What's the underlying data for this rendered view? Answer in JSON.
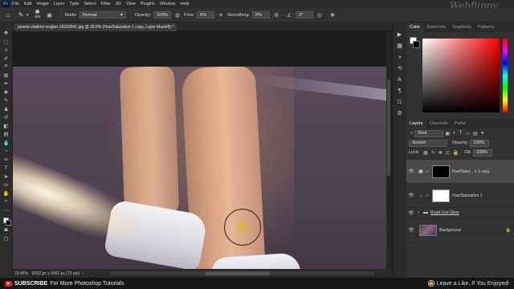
{
  "menubar": {
    "logo": "Ps",
    "items": [
      "File",
      "Edit",
      "Image",
      "Layer",
      "Type",
      "Select",
      "Filter",
      "3D",
      "View",
      "Plugins",
      "Window",
      "Help"
    ],
    "watermark": "Webflippy"
  },
  "options": {
    "brush_size": "400",
    "mode_label": "Mode:",
    "mode_value": "Normal",
    "opacity_label": "Opacity:",
    "opacity_value": "100%",
    "flow_label": "Flow:",
    "flow_value": "5%",
    "smoothing_label": "Smoothing:",
    "smoothing_value": "0%",
    "angle_value": "0°"
  },
  "document": {
    "tab_title": "pexels-vladimir-srajber-18103941.jpg @ 29.5% (Hue/Saturation 1 copy, Layer Mask/8) *"
  },
  "status": {
    "zoom": "29.46%",
    "info": "8192 px x 5462 px (72 ppi)"
  },
  "color_panel": {
    "tabs": [
      "Color",
      "Swatches",
      "Gradients",
      "Patterns"
    ],
    "fg": "#ffffff",
    "bg": "#000000"
  },
  "layers_panel": {
    "tabs": [
      "Layers",
      "Channels",
      "Paths"
    ],
    "kind_label": "Kind",
    "blend_mode": "Screen",
    "opacity_label": "Opacity:",
    "opacity_value": "100%",
    "lock_label": "Lock:",
    "fill_label": "Fill:",
    "fill_value": "100%",
    "layers": [
      {
        "name": "Hue/Satur... n 1 copy",
        "selected": true,
        "mask": "black"
      },
      {
        "name": "Hue/Saturation 1",
        "selected": false,
        "mask": "white"
      },
      {
        "name": "Road Line Glow",
        "selected": false
      },
      {
        "name": "Background",
        "selected": false
      }
    ]
  },
  "banner": {
    "left_bold": "SUBSCRIBE",
    "left_rest": "For More Photoshop Tutorials",
    "right": "Leave a Like, If You Enjoyed!"
  }
}
